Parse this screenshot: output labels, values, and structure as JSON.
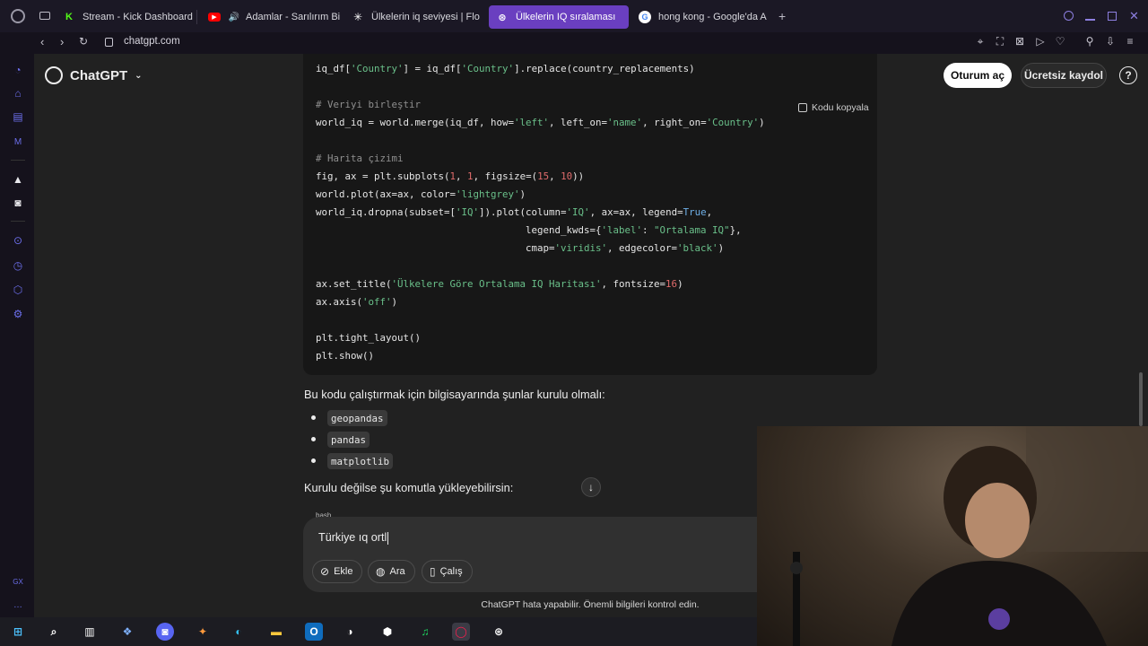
{
  "browser": {
    "tabs": [
      {
        "label": "Stream - Kick Dashboard",
        "icon": "kick-icon",
        "color": "#53fc18"
      },
      {
        "label": "Adamlar - Sarılırım Bi",
        "icon": "youtube-icon",
        "color": "#ff0000",
        "sound": true
      },
      {
        "label": "Ülkelerin iq seviyesi | Flo",
        "icon": "flourish-icon",
        "color": "#ffffff"
      },
      {
        "label": "Ülkelerin IQ sıralaması",
        "icon": "chatgpt-icon",
        "color": "#ffffff",
        "active": true
      },
      {
        "label": "hong kong - Google'da A",
        "icon": "google-icon",
        "color": "#4285f4"
      }
    ],
    "new_tab": "+",
    "url": "chatgpt.com"
  },
  "header": {
    "brand": "ChatGPT",
    "login": "Oturum aç",
    "signup": "Ücretsiz kaydol",
    "help": "?"
  },
  "code": {
    "copy_label": "Kodu kopyala",
    "lines": [
      "iq_df['Country'] = iq_df['Country'].replace(country_replacements)",
      "",
      "# Veriyi birleştir",
      "world_iq = world.merge(iq_df, how='left', left_on='name', right_on='Country')",
      "",
      "# Harita çizimi",
      "fig, ax = plt.subplots(1, 1, figsize=(15, 10))",
      "world.plot(ax=ax, color='lightgrey')",
      "world_iq.dropna(subset=['IQ']).plot(column='IQ', ax=ax, legend=True,",
      "                                    legend_kwds={'label': \"Ortalama IQ\"},",
      "                                    cmap='viridis', edgecolor='black')",
      "",
      "ax.set_title('Ülkelere Göre Ortalama IQ Haritası', fontsize=16)",
      "ax.axis('off')",
      "",
      "plt.tight_layout()",
      "plt.show()"
    ]
  },
  "content": {
    "para1": "Bu kodu çalıştırmak için bilgisayarında şunlar kurulu olmalı:",
    "packages": [
      "geopandas",
      "pandas",
      "matplotlib"
    ],
    "para2": "Kurulu değilse şu komutla yükleyebilirsin:",
    "bash_label": "bash"
  },
  "composer": {
    "text": "Türkiye ıq ortl",
    "attach": "Ekle",
    "search": "Ara",
    "study": "Çalış",
    "disclaimer": "ChatGPT hata yapabilir. Önemli bilgileri kontrol edin."
  }
}
